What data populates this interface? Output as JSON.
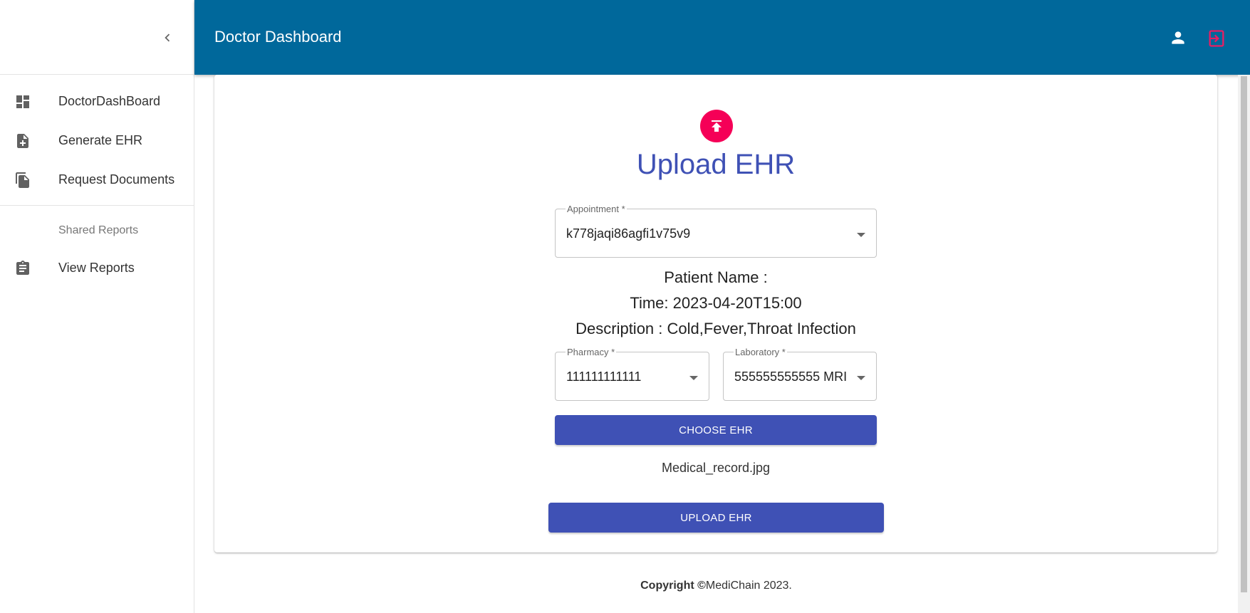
{
  "app": {
    "title": "Doctor Dashboard"
  },
  "sidebar": {
    "items": [
      {
        "label": "DoctorDashBoard",
        "icon": "dashboard-icon"
      },
      {
        "label": "Generate EHR",
        "icon": "note-add-icon"
      },
      {
        "label": "Request Documents",
        "icon": "file-copy-icon"
      }
    ],
    "subheader": "Shared Reports",
    "shared_items": [
      {
        "label": "View Reports",
        "icon": "assignment-icon"
      }
    ]
  },
  "form": {
    "title": "Upload EHR",
    "appointment": {
      "label": "Appointment *",
      "value": "k778jaqi86agfi1v75v9"
    },
    "patient_line": "Patient Name :",
    "time_line": "Time: 2023-04-20T15:00",
    "description_line": "Description : Cold,Fever,Throat Infection",
    "pharmacy": {
      "label": "Pharmacy *",
      "value": "111111111111"
    },
    "laboratory": {
      "label": "Laboratory *",
      "value": "555555555555 MRI"
    },
    "choose_label": "CHOOSE EHR",
    "file_name": "Medical_record.jpg",
    "upload_label": "UPLOAD EHR"
  },
  "footer": {
    "copyright_bold": "Copyright ©",
    "copyright_rest": "MediChain 2023."
  },
  "colors": {
    "appbar": "#00689b",
    "primary": "#3f51b5",
    "accent": "#f50057",
    "logout": "#e91e63"
  }
}
